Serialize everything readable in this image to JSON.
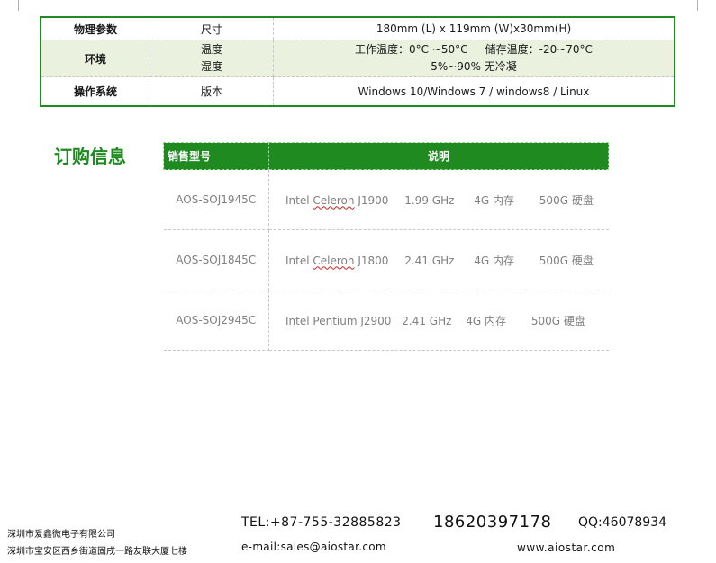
{
  "spec_table": {
    "rows": [
      {
        "category": "物理参数",
        "items": [
          "尺寸"
        ],
        "values": [
          "180mm (L) x 119mm (W)x30mm(H)"
        ]
      },
      {
        "category": "环境",
        "items": [
          "温度",
          "湿度"
        ],
        "values": [
          "工作温度：0°C ~50°C     储存温度：-20~70°C",
          "5%~90% 无冷凝"
        ]
      },
      {
        "category": "操作系统",
        "items": [
          "版本"
        ],
        "values": [
          "Windows 10/Windows 7 / windows8 / Linux"
        ]
      }
    ]
  },
  "order": {
    "title": "订购信息",
    "header": {
      "model": "销售型号",
      "description": "说明"
    },
    "rows": [
      {
        "model": "AOS-SOJ1945C",
        "cpu_prefix": "Intel ",
        "cpu_mark": "Celeron",
        "cpu_suffix": " J1900",
        "freq": "1.99 GHz",
        "ram": "4G 内存",
        "disk": "500G 硬盘"
      },
      {
        "model": "AOS-SOJ1845C",
        "cpu_prefix": "Intel ",
        "cpu_mark": "Celeron",
        "cpu_suffix": " J1800",
        "freq": "2.41 GHz",
        "ram": "4G 内存",
        "disk": "500G 硬盘"
      },
      {
        "model": "AOS-SOJ2945C",
        "cpu_prefix": "Intel ",
        "cpu_mark": "Pentium",
        "cpu_suffix": " J2900",
        "freq": "2.41 GHz",
        "ram": "4G 内存",
        "disk": "500G 硬盘"
      }
    ]
  },
  "footer": {
    "company": "深圳市爱鑫微电子有限公司",
    "address": "深圳市宝安区西乡街道固戌一路友联大厦七楼",
    "tel": "TEL:+87-755-32885823",
    "phone": "18620397178",
    "qq": "QQ:46078934",
    "email": "e-mail:sales@aiostar.com",
    "website": "www.aiostar.com"
  },
  "colors": {
    "accent": "#1f8a1f",
    "row_highlight": "#eaf1de",
    "muted_text": "#808080",
    "spellcheck": "#d02020"
  }
}
